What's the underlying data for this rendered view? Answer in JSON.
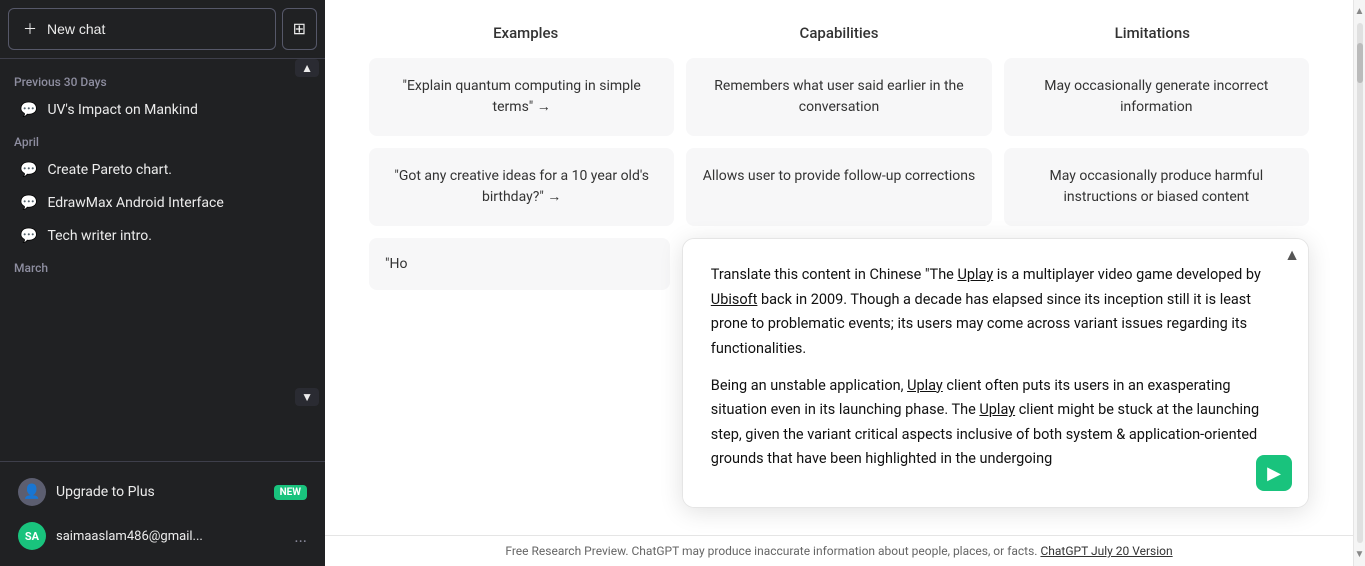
{
  "sidebar": {
    "new_chat_label": "New chat",
    "layout_icon": "⊞",
    "scroll_up_icon": "▲",
    "scroll_down_icon": "▼",
    "sections": [
      {
        "label": "Previous 30 Days",
        "items": [
          {
            "id": "uv-impact",
            "label": "UV's Impact on Mankind"
          }
        ]
      },
      {
        "label": "April",
        "items": [
          {
            "id": "pareto-chart",
            "label": "Create Pareto chart."
          },
          {
            "id": "edrawmax",
            "label": "EdrawMax Android Interface"
          },
          {
            "id": "tech-writer",
            "label": "Tech writer intro."
          }
        ]
      },
      {
        "label": "March",
        "items": []
      }
    ],
    "upgrade": {
      "icon": "👤",
      "label": "Upgrade to Plus",
      "badge": "NEW"
    },
    "user": {
      "avatar": "SA",
      "email": "saimaaslam486@gmail...",
      "dots": "..."
    }
  },
  "main": {
    "table": {
      "headers": [
        "Examples",
        "Capabilities",
        "Limitations"
      ],
      "rows": [
        [
          "\"Explain quantum computing in simple terms\" →",
          "Remembers what user said earlier in the conversation",
          "May occasionally generate incorrect information"
        ],
        [
          "\"Got any creative ideas for a 10 year old's birthday?\" →",
          "Allows user to provide follow-up corrections",
          "May occasionally produce harmful instructions or biased content"
        ]
      ]
    },
    "popup": {
      "left_stub": "\"Ho",
      "content_paragraphs": [
        "Translate this content in Chinese \"The Uplay is a multiplayer video game developed by Ubisoft back in 2009. Though a decade has elapsed since its inception still it is least prone to problematic events; its users may come across variant issues regarding its functionalities.",
        "Being an unstable application, Uplay client often puts its users in an exasperating situation even in its launching phase. The Uplay client might be stuck at the launching step, given the variant critical aspects inclusive of both system & application-oriented grounds that have been highlighted in the undergoing"
      ],
      "underlined_words": [
        "Uplay",
        "Ubisoft",
        "Uplay",
        "Uplay"
      ],
      "scroll_up_icon": "▲",
      "send_icon": "▶"
    },
    "footer": {
      "text": "Free Research Preview. ChatGPT may produce inaccurate information about people, places, or facts.",
      "link_text": "ChatGPT July 20 Version"
    }
  }
}
